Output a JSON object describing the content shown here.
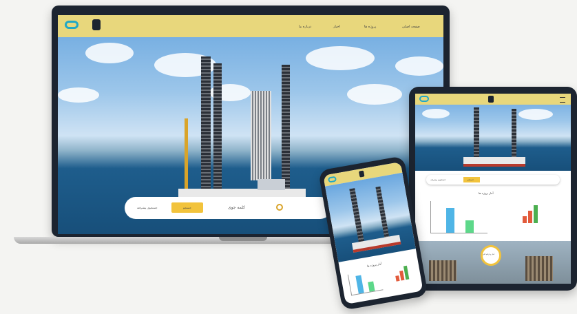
{
  "laptop": {
    "nav": [
      "صفحه اصلی",
      "پروژه ها",
      "اخبار",
      "درباره ما"
    ],
    "search": {
      "label": "کلمه جوی",
      "button": "جستجو",
      "field": "جستجوی پیشرفته"
    }
  },
  "tablet": {
    "section_title": "آمار پروژه ها",
    "search_button": "جستجو",
    "search_field": "جستجوی پیشرفته",
    "infographic": "آمار و ارقام کلی"
  },
  "phone": {
    "section_title": "آمار پروژه ها"
  },
  "colors": {
    "accent": "#e8d77c",
    "button": "#f2c33c",
    "sea": "#174f7a",
    "frame": "#1c2430"
  }
}
